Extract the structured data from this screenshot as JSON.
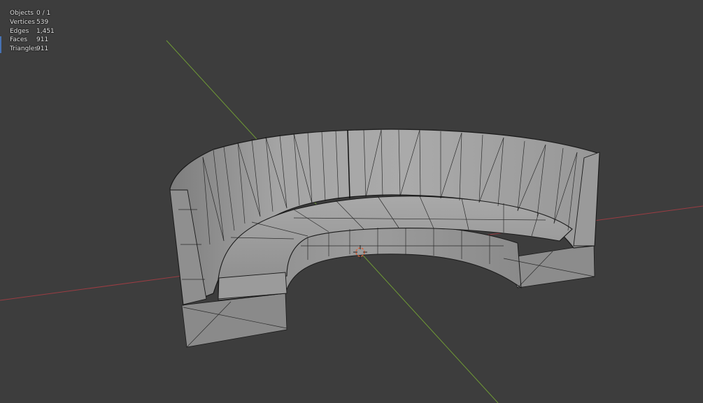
{
  "stats": [
    {
      "label": "Objects",
      "value": "0 / 1"
    },
    {
      "label": "Vertices",
      "value": "539"
    },
    {
      "label": "Edges",
      "value": "1,451"
    },
    {
      "label": "Faces",
      "value": "911"
    },
    {
      "label": "Triangles",
      "value": "911"
    }
  ],
  "colors": {
    "background": "#3d3d3d",
    "x_axis": "#9b3d43",
    "y_axis": "#6f9a36",
    "mesh_face": "#9a9a9a",
    "mesh_edge": "#1a1a1a",
    "cursor": "#d8623b"
  },
  "icons": {
    "cursor": "3d-cursor-icon"
  }
}
